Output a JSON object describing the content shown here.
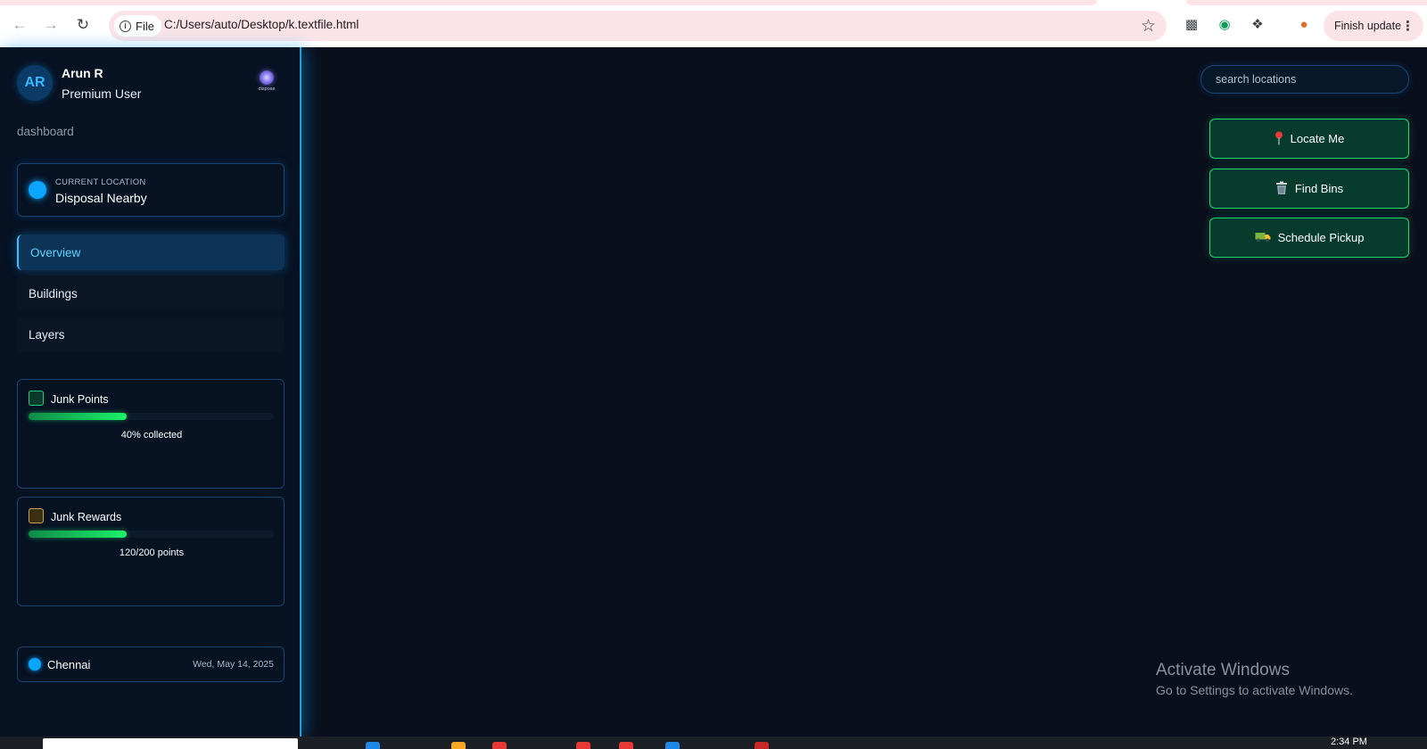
{
  "browser": {
    "site_chip": "File",
    "url": "C:/Users/auto/Desktop/k.textfile.html",
    "finish_update": "Finish update"
  },
  "user": {
    "initials": "AR",
    "name": "Arun R",
    "role": "Premium User"
  },
  "sidebar": {
    "section_label": "dashboard",
    "location_card": {
      "small_label": "CURRENT LOCATION",
      "value": "Disposal Nearby"
    },
    "nav": [
      {
        "label": "Overview",
        "active": true
      },
      {
        "label": "Buildings",
        "active": false
      },
      {
        "label": "Layers",
        "active": false
      }
    ],
    "stats": [
      {
        "title": "Junk Points",
        "progress": 0.4,
        "subtitle": "40% collected",
        "color": "#1ccf7a"
      },
      {
        "title": "Junk Rewards",
        "progress": 0.4,
        "subtitle": "120/200 points",
        "color": "#c7a64a"
      }
    ],
    "pager": {
      "count": 2,
      "active": 0
    },
    "footer": {
      "city": "Chennai",
      "date": "Wed, May 14, 2025"
    }
  },
  "main": {
    "search_placeholder": "search locations",
    "actions": [
      {
        "label": "Locate Me",
        "icon": "pin-icon"
      },
      {
        "label": "Find Bins",
        "icon": "trash-icon"
      },
      {
        "label": "Schedule Pickup",
        "icon": "truck-icon"
      }
    ]
  },
  "watermark": {
    "title": "Activate Windows",
    "subtitle": "Go to Settings to activate Windows."
  },
  "taskbar": {
    "time": "2:34 PM"
  },
  "colors": {
    "accent": "#0aa6ff",
    "success": "#1ed672",
    "background": "#0a0f1c",
    "sidebar": "#071223"
  }
}
